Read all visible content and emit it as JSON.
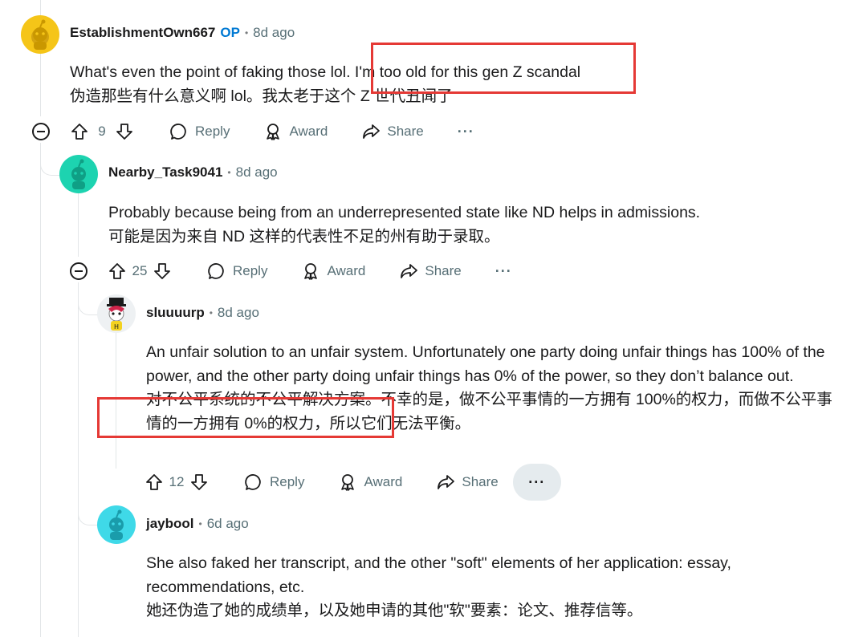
{
  "comments": [
    {
      "username": "EstablishmentOwn667",
      "op_label": "OP",
      "time": "8d ago",
      "text_en": "What's even the point of faking those lol. I'm too old for this gen Z scandal",
      "text_zh": "伪造那些有什么意义啊 lol。我太老于这个 Z 世代丑闻了",
      "votes": "9",
      "reply": "Reply",
      "award": "Award",
      "share": "Share",
      "more": "···",
      "avatar_color": "#f5c518"
    },
    {
      "username": "Nearby_Task9041",
      "time": "8d ago",
      "text_en": "Probably because being from an underrepresented state like ND helps in admissions.",
      "text_zh": "可能是因为来自 ND 这样的代表性不足的州有助于录取。",
      "votes": "25",
      "reply": "Reply",
      "award": "Award",
      "share": "Share",
      "more": "···",
      "avatar_color": "#1dd3b0"
    },
    {
      "username": "sluuuurp",
      "time": "8d ago",
      "text_en": "An unfair solution to an unfair system. Unfortunately one party doing unfair things has 100% of the power, and the other party doing unfair things has 0% of the power, so they don’t balance out.",
      "text_zh": "对不公平系统的不公平解决方案。不幸的是，做不公平事情的一方拥有 100%的权力，而做不公平事情的一方拥有 0%的权力，所以它们无法平衡。",
      "votes": "12",
      "reply": "Reply",
      "award": "Award",
      "share": "Share",
      "more": "···"
    },
    {
      "username": "jaybool",
      "time": "6d ago",
      "text_en": "She also faked her transcript, and the other \"soft\" elements of her application: essay, recommendations, etc.",
      "text_zh": "她还伪造了她的成绩单，以及她申请的其他\"软\"要素：论文、推荐信等。",
      "avatar_color": "#3fd9e8"
    }
  ],
  "colors": {
    "highlight_box": "#e53935",
    "meta_text": "#576f76",
    "op_blue": "#0079d3"
  }
}
